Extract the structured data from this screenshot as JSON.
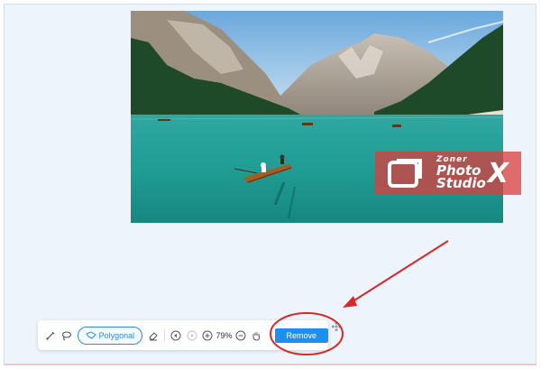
{
  "watermark": {
    "line1": "Zoner",
    "line2": "Photo",
    "line3": "Studio",
    "line4": "X"
  },
  "toolbar": {
    "brush_icon": "brush-icon",
    "lasso_icon": "lasso-icon",
    "polygonal_label": "Polygonal",
    "polygonal_icon": "polygonal-lasso-icon",
    "eraser_icon": "eraser-icon",
    "undo_icon": "undo-icon",
    "redo_icon": "redo-icon",
    "zoom_in_icon": "zoom-in-icon",
    "zoom_level": "79%",
    "zoom_out_icon": "zoom-out-icon",
    "hand_icon": "hand-icon",
    "remove_label": "Remove",
    "move_icon": "move-icon"
  },
  "colors": {
    "accent": "#1d8ff0",
    "annotation": "#d42a2a",
    "background": "#eef4fb"
  }
}
